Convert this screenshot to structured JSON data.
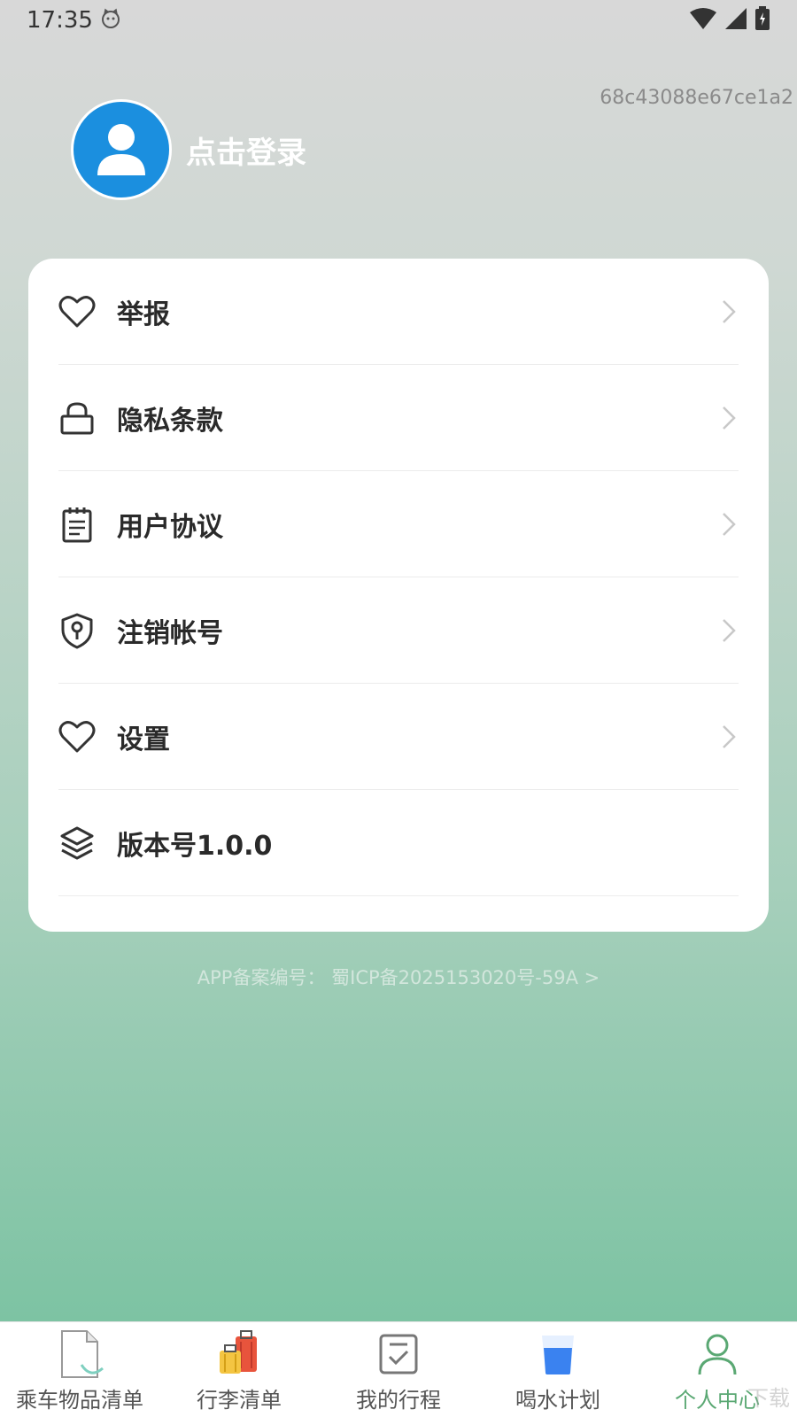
{
  "status_bar": {
    "time": "17:35"
  },
  "device_id": "68c43088e67ce1a2",
  "profile": {
    "login_label": "点击登录"
  },
  "menu": {
    "items": [
      {
        "label": "举报",
        "icon": "heart-icon"
      },
      {
        "label": "隐私条款",
        "icon": "lock-icon"
      },
      {
        "label": "用户协议",
        "icon": "notepad-icon"
      },
      {
        "label": "注销帐号",
        "icon": "shield-key-icon"
      },
      {
        "label": "设置",
        "icon": "heart-icon"
      },
      {
        "label": "版本号1.0.0",
        "icon": "layers-icon"
      }
    ]
  },
  "icp_text": "APP备案编号：  蜀ICP备2025153020号-59A >",
  "tabs": [
    {
      "label": "乘车物品清单",
      "icon": "document-icon"
    },
    {
      "label": "行李清单",
      "icon": "luggage-icon"
    },
    {
      "label": "我的行程",
      "icon": "checklist-icon"
    },
    {
      "label": "喝水计划",
      "icon": "water-cup-icon"
    },
    {
      "label": "个人中心",
      "icon": "person-icon",
      "active": true
    }
  ],
  "watermark": "下载",
  "colors": {
    "avatar_blue": "#1b8fdf",
    "active_tab": "#5aa873",
    "card": "#ffffff"
  }
}
